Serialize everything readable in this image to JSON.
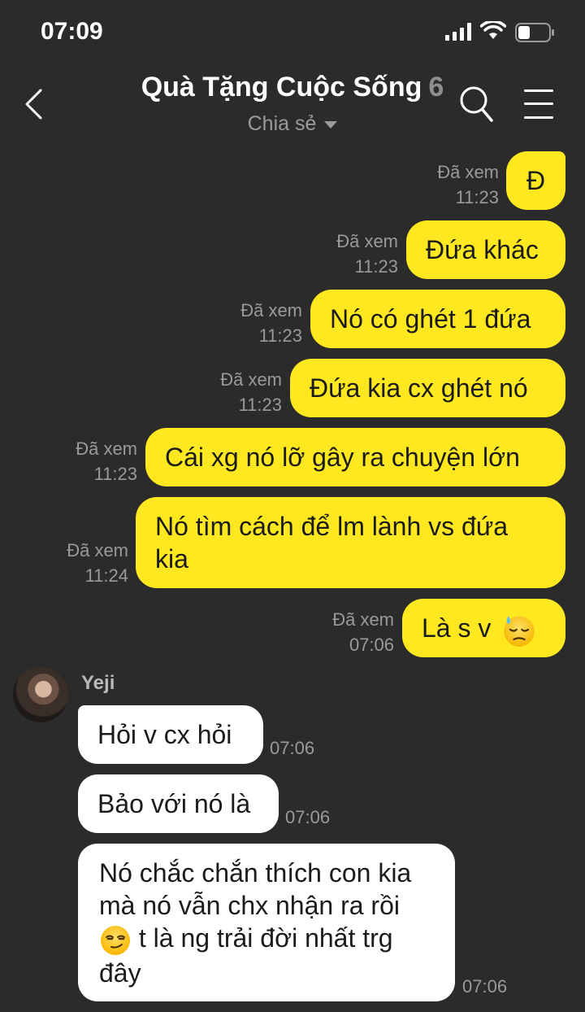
{
  "status": {
    "time": "07:09"
  },
  "header": {
    "title": "Quà Tặng Cuộc Sống",
    "member_count": "6",
    "subtitle": "Chia sẻ",
    "icons": [
      "back-chevron-icon",
      "search-icon",
      "menu-icon"
    ]
  },
  "colors": {
    "background": "#2b2b2b",
    "outgoing_bubble": "#ffe81f",
    "incoming_bubble": "#ffffff",
    "meta_text": "#9a9a9a"
  },
  "messages": [
    {
      "text": "Đ",
      "seen": "Đã xem",
      "time": "11:23"
    },
    {
      "text": "Đứa khác",
      "seen": "Đã xem",
      "time": "11:23"
    },
    {
      "text": "Nó có ghét 1 đứa",
      "seen": "Đã xem",
      "time": "11:23"
    },
    {
      "text": "Đứa kia cx ghét nó",
      "seen": "Đã xem",
      "time": "11:23"
    },
    {
      "text": "Cái xg nó lỡ gây ra chuyện lớn",
      "seen": "Đã xem",
      "time": "11:23"
    },
    {
      "text": "Nó tìm cách để lm lành vs đứa kia",
      "seen": "Đã xem",
      "time": "11:24"
    },
    {
      "text": "Là s v",
      "emoji": "downcast-sweat-face",
      "seen": "Đã xem",
      "time": "07:06"
    }
  ],
  "incoming": {
    "sender": "Yeji",
    "messages": [
      {
        "text": "Hỏi v cx hỏi",
        "time": "07:06"
      },
      {
        "text": "Bảo với nó là",
        "time": "07:06"
      },
      {
        "text_before": "Nó chắc chắn thích con kia mà nó vẫn chx nhận ra rồi",
        "emoji": "smirking-face",
        "text_after": "t là ng trải đời nhất trg đây",
        "time": "07:06"
      }
    ]
  }
}
